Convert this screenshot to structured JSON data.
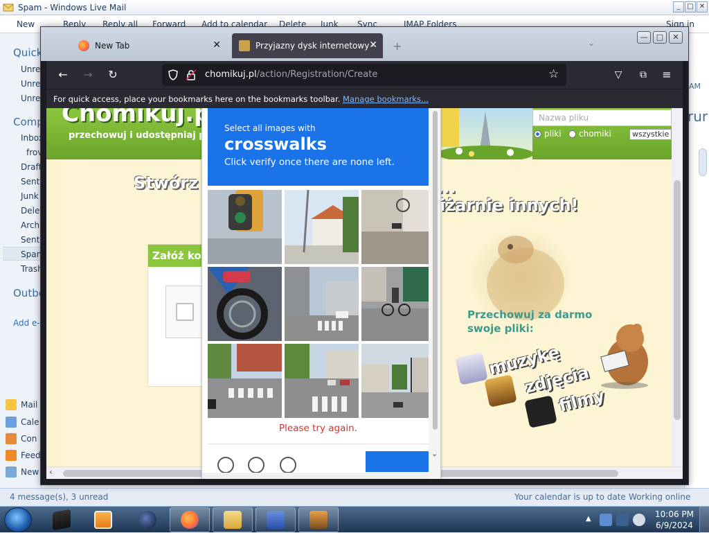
{
  "wlm": {
    "title": "Spam - Windows Live Mail",
    "ribbon": [
      "New",
      "Reply",
      "Reply all",
      "Forward",
      "Add to calendar",
      "Delete",
      "Junk",
      "Sync",
      "IMAP Folders"
    ],
    "sign_in": "Sign in",
    "nav": {
      "quick_views": "Quick",
      "quick_items": [
        "Unrea",
        "Unrea",
        "Unrea"
      ],
      "account": "Comp",
      "folders": [
        "Inbox",
        "frov",
        "Draft",
        "Sent",
        "Junk",
        "Delet",
        "Archi",
        "Sent",
        "Spam",
        "Trash"
      ],
      "outbox": "Outbo",
      "add_account": "Add e-",
      "bottom": [
        "Mail",
        "Cale",
        "Con",
        "Feed",
        "New"
      ]
    },
    "right_time": "AM",
    "right_text": "rur",
    "status_left": "4 message(s), 3 unread",
    "status_calendar": "Your calendar is up to date",
    "status_online": "Working online"
  },
  "firefox": {
    "tabs": [
      {
        "label": "New Tab"
      },
      {
        "label": "Przyjazny dysk internetowy - Ch"
      }
    ],
    "url_domain": "chomikuj.pl",
    "url_path": "/action/Registration/Create",
    "bookmarks_hint": "For quick access, place your bookmarks here on the bookmarks toolbar.",
    "bookmarks_link": "Manage bookmarks..."
  },
  "site": {
    "logo": "Chomikuj.pl",
    "tagline": "przechowuj i udostępniaj pliki",
    "search_placeholder": "Nazwa pliku",
    "radio_files": "pliki",
    "radio_hamsters": "chomiki",
    "select_all": "wszystkie",
    "headline_left": "Stwórz",
    "headline_dots": "...",
    "headline_right": "iżarnie innych!",
    "register_title": "Załóż konto",
    "promo_title_1": "Przechowuj za darmo",
    "promo_title_2": "swoje pliki:",
    "promo_items": [
      "muzykę",
      "zdjęcia",
      "filmy"
    ]
  },
  "captcha": {
    "instruction": "Select all images with",
    "target": "crosswalks",
    "hint": "Click verify once there are none left.",
    "error": "Please try again.",
    "tiles": [
      "traffic-light",
      "street-house",
      "street-motorbike",
      "motorcycle-wheel",
      "street-crosswalk",
      "street-cyclist",
      "crosswalk-left",
      "crosswalk-cars",
      "intersection"
    ]
  },
  "taskbar": {
    "time": "10:06 PM",
    "date": "6/9/2024"
  },
  "colors": {
    "captcha_blue": "#1a73e8",
    "error_red": "#d93025",
    "site_green": "#8cc63f",
    "promo_teal": "#3d9a8c"
  }
}
